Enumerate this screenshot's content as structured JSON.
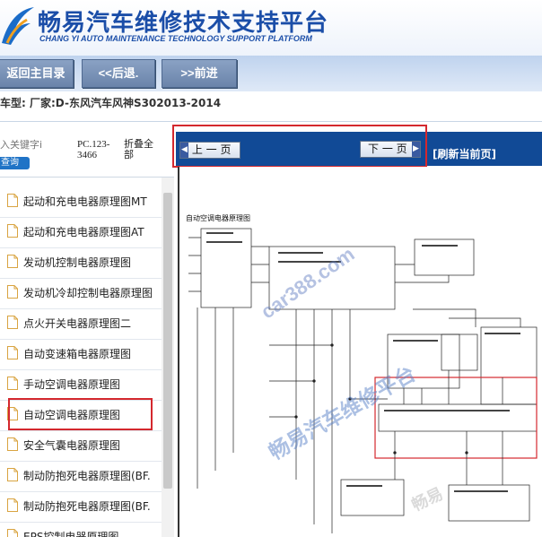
{
  "header": {
    "title": "畅易汽车维修技术支持平台",
    "subtitle": "CHANG YI AUTO MAINTENANCE TECHNOLOGY SUPPORT PLATFORM",
    "logo_icon": "blue-r-swoosh-logo-icon"
  },
  "nav": {
    "home_label": "返回主目录",
    "back_label": "<<后退.",
    "forward_label": ">>前进"
  },
  "car_info": {
    "text": "车型:   厂家:D-东风汽车风神S302013-2014"
  },
  "search": {
    "placeholder": "入关键字i",
    "button_label": "查询",
    "pc_code": "PC.123-3466",
    "collapse_label": "折叠全部"
  },
  "sidebar": {
    "items": [
      {
        "label": "起动和充电电器原理图MT",
        "icon": "document-icon"
      },
      {
        "label": "起动和充电电器原理图AT",
        "icon": "document-icon"
      },
      {
        "label": "发动机控制电器原理图",
        "icon": "document-icon"
      },
      {
        "label": "发动机冷却控制电器原理图",
        "icon": "document-icon"
      },
      {
        "label": "点火开关电器原理图二",
        "icon": "document-icon"
      },
      {
        "label": "自动变速箱电器原理图",
        "icon": "document-icon"
      },
      {
        "label": "手动空调电器原理图",
        "icon": "document-icon"
      },
      {
        "label": "自动空调电器原理图",
        "icon": "document-icon",
        "selected": true
      },
      {
        "label": "安全气囊电器原理图",
        "icon": "document-icon"
      },
      {
        "label": "制动防抱死电器原理图(BF.",
        "icon": "document-icon"
      },
      {
        "label": "制动防抱死电器原理图(BF.",
        "icon": "document-icon"
      },
      {
        "label": "EPS控制电器原理图",
        "icon": "document-icon"
      }
    ]
  },
  "content": {
    "prev_page_label": "上 一 页",
    "next_page_label": "下 一 页",
    "refresh_label": "[刷新当前页]",
    "diagram_title": "自动空调电器原理图"
  },
  "watermarks": {
    "url": "car388.com",
    "platform": "畅易汽车维修平台",
    "bottom": "畅易"
  },
  "colors": {
    "brand_blue": "#1b4ea8",
    "content_bar": "#114a96",
    "highlight_red": "#d4282e",
    "nav_button": "#6a84aa"
  }
}
